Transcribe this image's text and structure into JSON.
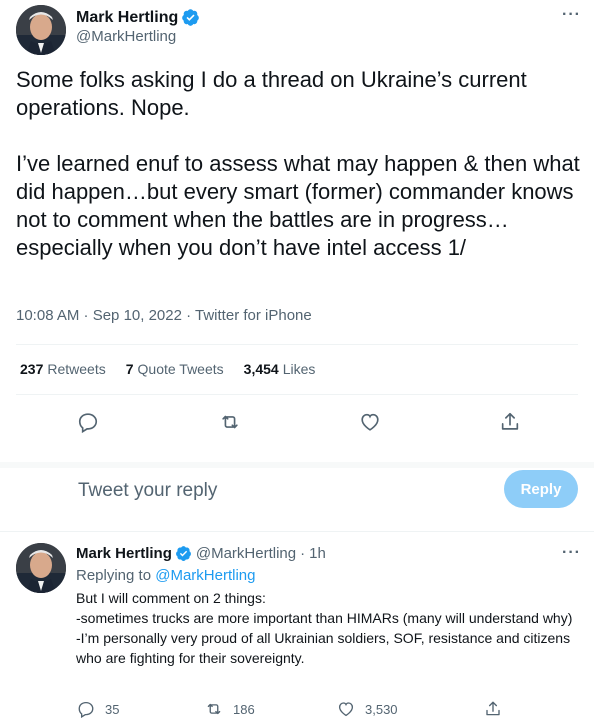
{
  "main_tweet": {
    "author_name": "Mark Hertling",
    "author_handle": "@MarkHertling",
    "more_label": "···",
    "text": "Some folks asking I do a thread on Ukraine’s current operations. Nope.\n\nI’ve learned enuf to assess what may happen & then what did happen…but every smart (former) commander knows not to comment when the battles are in progress…especially when you don’t have intel access 1/",
    "timestamp": "10:08 AM · Sep 10, 2022 · Twitter for iPhone",
    "stats": {
      "retweets_count": "237",
      "retweets_label": "Retweets",
      "quotes_count": "7",
      "quotes_label": "Quote Tweets",
      "likes_count": "3,454",
      "likes_label": "Likes"
    },
    "icons": [
      "reply-icon",
      "retweet-icon",
      "like-icon",
      "share-icon"
    ]
  },
  "reply_composer": {
    "placeholder": "Tweet your reply",
    "button_label": "Reply"
  },
  "reply_tweet": {
    "author_name": "Mark Hertling",
    "author_handle": "@MarkHertling",
    "time_sep": "·",
    "time": "1h",
    "more_label": "···",
    "replying_to_label": "Replying to",
    "replying_to_handle": "@MarkHertling",
    "text": "But I will comment on 2 things:\n -sometimes trucks are more important than HIMARs (many will understand why)\n-I’m personally very proud of all Ukrainian soldiers, SOF, resistance and citizens who are fighting for their sovereignty.",
    "reply_count": "35",
    "retweet_count": "186",
    "like_count": "3,530"
  },
  "colors": {
    "verified_blue": "#1d9bf0",
    "secondary_text": "#536471",
    "reply_button_disabled": "#8ecdf8"
  }
}
